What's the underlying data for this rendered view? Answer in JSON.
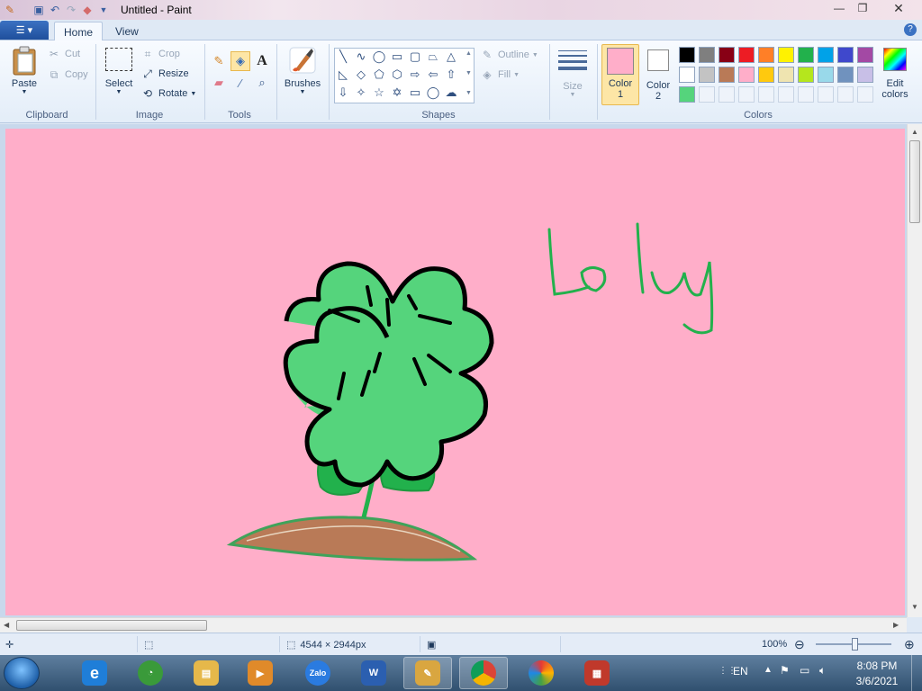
{
  "window": {
    "title": "Untitled - Paint"
  },
  "tabs": [
    {
      "label": "Home",
      "active": true
    },
    {
      "label": "View",
      "active": false
    }
  ],
  "ribbon": {
    "clipboard": {
      "group_label": "Clipboard",
      "paste": "Paste",
      "cut": "Cut",
      "copy": "Copy"
    },
    "image": {
      "group_label": "Image",
      "select": "Select",
      "crop": "Crop",
      "resize": "Resize",
      "rotate": "Rotate"
    },
    "tools": {
      "group_label": "Tools",
      "selected_tool": "fill-with-color"
    },
    "brushes": {
      "label": "Brushes"
    },
    "shapes": {
      "group_label": "Shapes",
      "outline": "Outline",
      "fill": "Fill"
    },
    "size": {
      "label": "Size"
    },
    "colors": {
      "group_label": "Colors",
      "color1_label_line1": "Color",
      "color1_label_line2": "1",
      "color2_label_line1": "Color",
      "color2_label_line2": "2",
      "color1_value": "#ffaec9",
      "color2_value": "#ffffff",
      "edit_label_line1": "Edit",
      "edit_label_line2": "colors",
      "palette_row1": [
        "#000000",
        "#7f7f7f",
        "#880015",
        "#ed1c24",
        "#ff7f27",
        "#fff200",
        "#22b14c",
        "#00a2e8",
        "#3f48cc",
        "#a349a4"
      ],
      "palette_row2": [
        "#ffffff",
        "#c3c3c3",
        "#b97a57",
        "#ffaec9",
        "#ffc90e",
        "#efe4b0",
        "#b5e61d",
        "#99d9ea",
        "#7092be",
        "#c8bfe7"
      ],
      "palette_row3": [
        "#55d47c"
      ]
    }
  },
  "canvas": {
    "background": "#ffaec9",
    "drawing": "four-leaf clover flower",
    "handwriting": "Lo ly"
  },
  "statusbar": {
    "dimensions": "4544 × 2944px",
    "zoom": "100%"
  },
  "taskbar": {
    "apps": [
      "Internet Explorer",
      "Coc Coc",
      "File Explorer",
      "Media Player",
      "Zalo",
      "Word",
      "Paint",
      "Chrome",
      "Color app",
      "Tool app"
    ],
    "language": "EN",
    "time": "8:08 PM",
    "date": "3/6/2021"
  }
}
